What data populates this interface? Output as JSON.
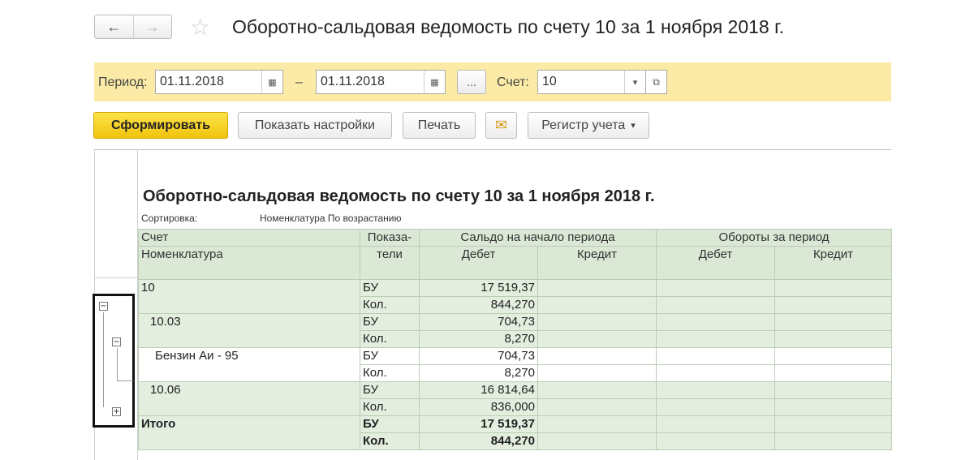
{
  "window": {
    "title": "Оборотно-сальдовая ведомость по счету 10 за 1 ноября 2018 г.",
    "back_icon": "←",
    "forward_icon": "→",
    "favorite_icon": "☆"
  },
  "filters": {
    "period_label": "Период:",
    "date_from": "01.11.2018",
    "dash": "–",
    "date_to": "01.11.2018",
    "calendar_icon": "▦",
    "more_label": "...",
    "account_label": "Счет:",
    "account_value": "10",
    "dropdown_icon": "▾",
    "open_icon": "⧉"
  },
  "toolbar": {
    "generate_label": "Сформировать",
    "settings_label": "Показать настройки",
    "print_label": "Печать",
    "email_icon": "✉",
    "register_label": "Регистр учета",
    "register_arrow": "▾"
  },
  "report": {
    "title": "Оборотно-сальдовая ведомость по счету 10 за 1 ноября 2018 г.",
    "sort_label": "Сортировка:",
    "sort_value": "Номенклатура По возрастанию",
    "headers": {
      "account": "Счет",
      "nomenclature": "Номенклатура",
      "indicators_1": "Показа-",
      "indicators_2": "тели",
      "opening_balance": "Сальдо на начало периода",
      "turnover": "Обороты за период",
      "debit": "Дебет",
      "credit": "Кредит"
    },
    "rows": [
      {
        "name": "10",
        "ind1": "БУ",
        "debit1": "17 519,37",
        "ind2": "Кол.",
        "debit2": "844,270"
      },
      {
        "name": "10.03",
        "ind1": "БУ",
        "debit1": "704,73",
        "ind2": "Кол.",
        "debit2": "8,270"
      },
      {
        "name": "Бензин Аи - 95",
        "ind1": "БУ",
        "debit1": "704,73",
        "ind2": "Кол.",
        "debit2": "8,270"
      },
      {
        "name": "10.06",
        "ind1": "БУ",
        "debit1": "16 814,64",
        "ind2": "Кол.",
        "debit2": "836,000"
      },
      {
        "name": "Итого",
        "ind1": "БУ",
        "debit1": "17 519,37",
        "ind2": "Кол.",
        "debit2": "844,270"
      }
    ]
  },
  "outline": {
    "collapse_icon": "−",
    "expand_icon": "+"
  },
  "colors": {
    "filter_bar": "#fbeba6",
    "primary_button": "#f5cd1a",
    "table_header": "#dbe8d6",
    "table_row": "#e3eedf"
  }
}
